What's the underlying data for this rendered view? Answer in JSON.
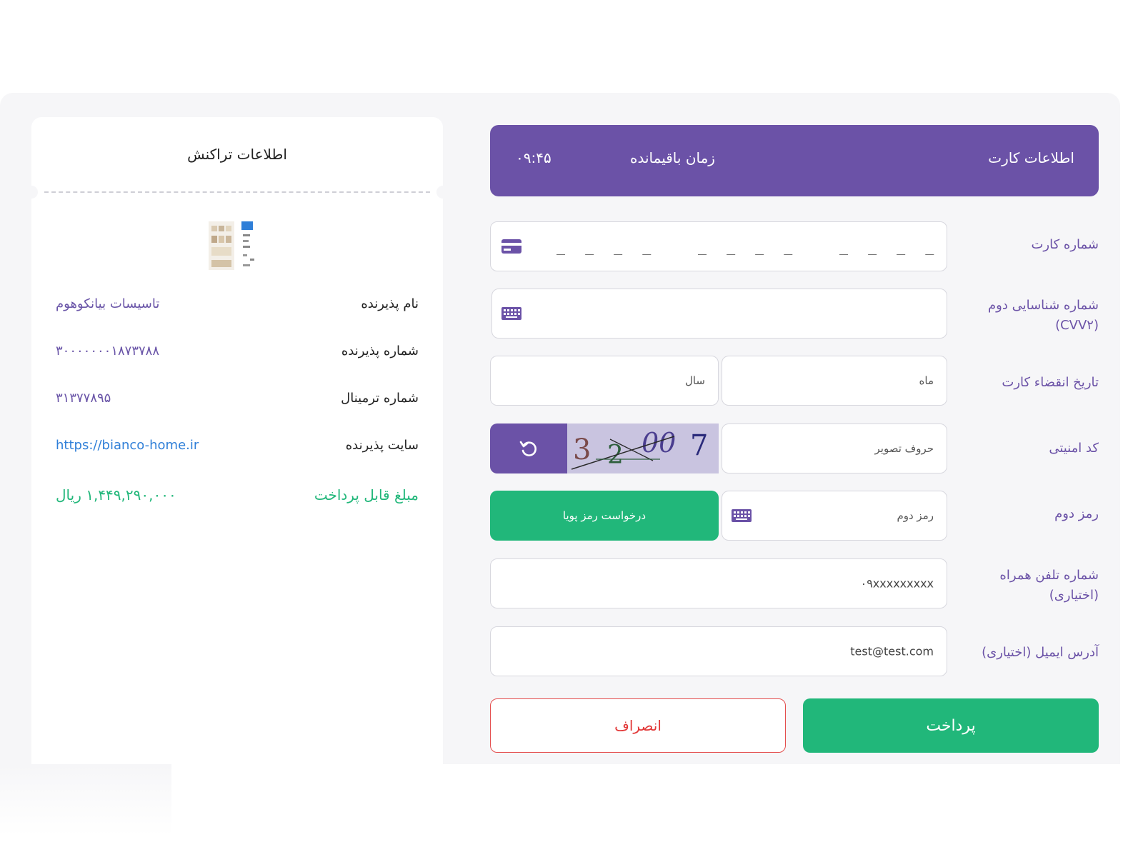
{
  "transaction": {
    "title": "اطلاعات تراکنش",
    "rows": [
      {
        "label": "نام پذیرنده",
        "value": "تاسیسات بیانکوهوم"
      },
      {
        "label": "شماره پذیرنده",
        "value": "۳۰۰۰۰۰۰۰۱۸۷۳۷۸۸"
      },
      {
        "label": "شماره ترمینال",
        "value": "۳۱۳۷۷۸۹۵"
      },
      {
        "label": "سایت پذیرنده",
        "value": "https://bianco-home.ir"
      },
      {
        "label": "مبلغ قابل پرداخت",
        "value": "۱,۴۴۹,۲۹۰,۰۰۰ ریال"
      }
    ]
  },
  "card_form": {
    "header": {
      "title": "اطلاعات کارت",
      "timer_label": "زمان باقیمانده",
      "timer_value": "۰۹:۴۵"
    },
    "card_number": {
      "label": "شماره کارت",
      "value": "_ _ _ _"
    },
    "cvv2": {
      "label_line1": "شماره شناسایی دوم",
      "label_line2": "(CVV۲)"
    },
    "expiry": {
      "label": "تاریخ انقضاء کارت",
      "month_placeholder": "ماه",
      "year_placeholder": "سال"
    },
    "captcha": {
      "label": "کد امنیتی",
      "placeholder": "حروف تصویر",
      "image_text": "3 2 00 7"
    },
    "second_pin": {
      "label": "رمز دوم",
      "placeholder": "رمز دوم",
      "otp_button": "درخواست رمز پویا"
    },
    "phone": {
      "label_line1": "شماره تلفن همراه",
      "label_line2": "(اختیاری)",
      "value": "۰۹xxxxxxxxx"
    },
    "email": {
      "label": "آدرس ایمیل (اختیاری)",
      "value": "test@test.com"
    }
  },
  "actions": {
    "pay": "پرداخت",
    "cancel": "انصراف"
  },
  "colors": {
    "primary": "#6b52a7",
    "success": "#21b77a",
    "danger": "#e44d4d",
    "link": "#2f7fd8"
  },
  "icons": [
    "credit-card-icon",
    "keyboard-icon",
    "refresh-icon"
  ]
}
